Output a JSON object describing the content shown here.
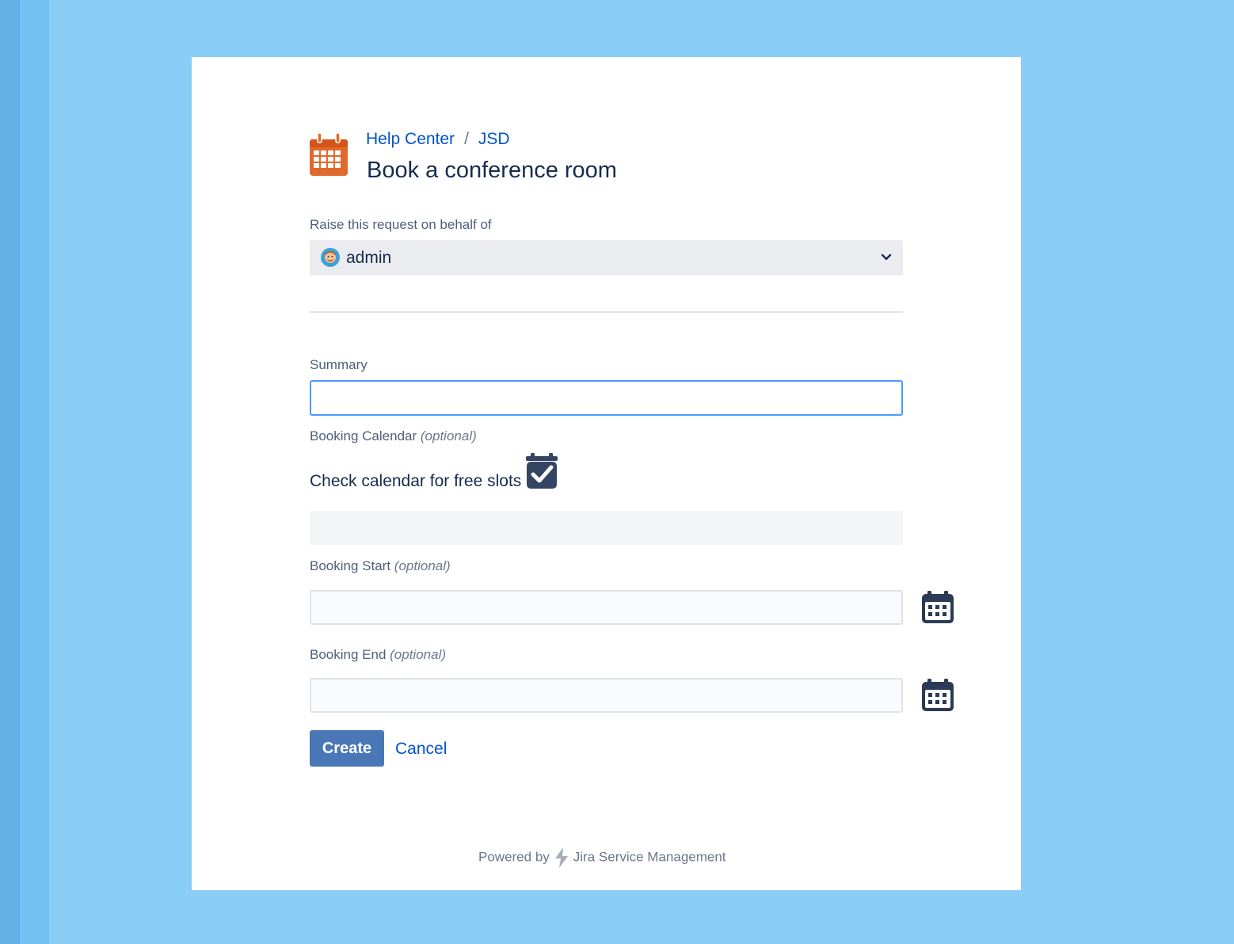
{
  "breadcrumb": {
    "items": [
      "Help Center",
      "JSD"
    ],
    "separator": "/"
  },
  "page": {
    "title": "Book a conference room",
    "icon": "calendar-icon"
  },
  "on_behalf": {
    "label": "Raise this request on behalf of",
    "selected": "admin",
    "avatar_icon": "admin-avatar-icon"
  },
  "summary": {
    "label": "Summary",
    "value": ""
  },
  "booking_calendar": {
    "label": "Booking Calendar",
    "optional": "(optional)",
    "check_text": "Check calendar for free slots",
    "icon": "calendar-check-icon"
  },
  "booking_start": {
    "label": "Booking Start",
    "optional": "(optional)",
    "value": ""
  },
  "booking_end": {
    "label": "Booking End",
    "optional": "(optional)",
    "value": ""
  },
  "actions": {
    "create": "Create",
    "cancel": "Cancel"
  },
  "footer": {
    "powered_by": "Powered by",
    "product": "Jira Service Management"
  },
  "colors": {
    "background": "#8acdf7",
    "primary_button": "#4a78b6",
    "link": "#0052cc",
    "portal_icon": "#e06a2c",
    "focus_border": "#4c9aff"
  }
}
